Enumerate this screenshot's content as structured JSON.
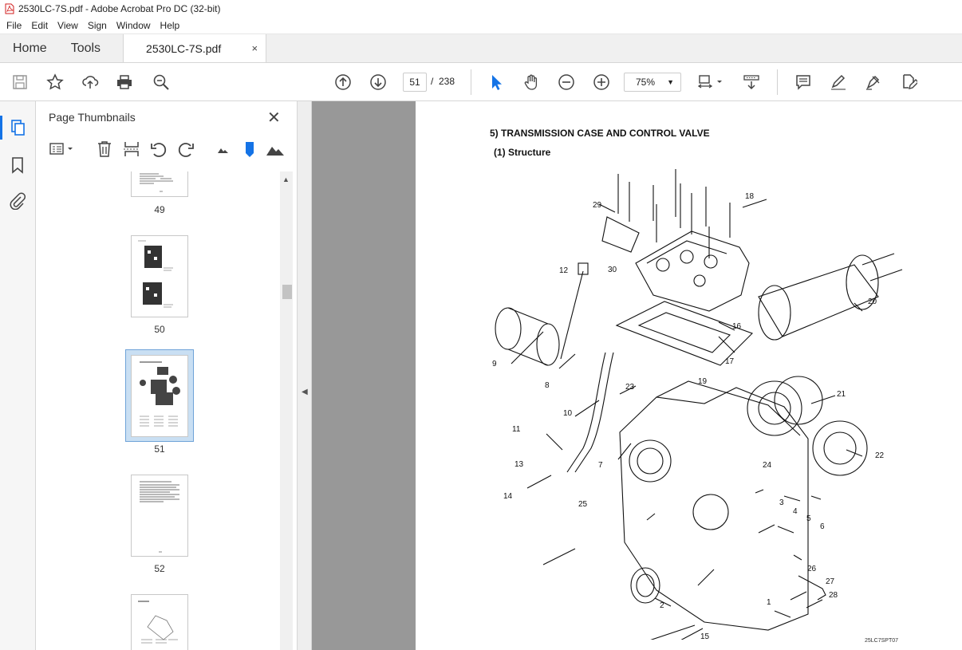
{
  "window": {
    "title": "2530LC-7S.pdf - Adobe Acrobat Pro DC (32-bit)"
  },
  "menu": [
    "File",
    "Edit",
    "View",
    "Sign",
    "Window",
    "Help"
  ],
  "tabs": {
    "home": "Home",
    "tools": "Tools",
    "doc": "2530LC-7S.pdf",
    "close": "×"
  },
  "toolbar": {
    "page_current": "51",
    "page_sep": "/",
    "page_total": "238",
    "zoom": "75%"
  },
  "panel": {
    "title": "Page Thumbnails",
    "close": "✕"
  },
  "thumbnails": [
    {
      "label": "49"
    },
    {
      "label": "50"
    },
    {
      "label": "51",
      "selected": true
    },
    {
      "label": "52"
    }
  ],
  "document": {
    "heading": "5) TRANSMISSION CASE AND CONTROL VALVE",
    "subheading": "(1) Structure",
    "figure_code": "25LC7SPT07",
    "callouts": [
      "1",
      "2",
      "3",
      "4",
      "5",
      "6",
      "7",
      "8",
      "9",
      "10",
      "11",
      "12",
      "13",
      "14",
      "15",
      "16",
      "17",
      "18",
      "19",
      "20",
      "21",
      "22",
      "23",
      "24",
      "25",
      "26",
      "27",
      "28",
      "29",
      "30"
    ]
  },
  "colors": {
    "accent": "#1473e6",
    "gray_canvas": "#989898"
  }
}
